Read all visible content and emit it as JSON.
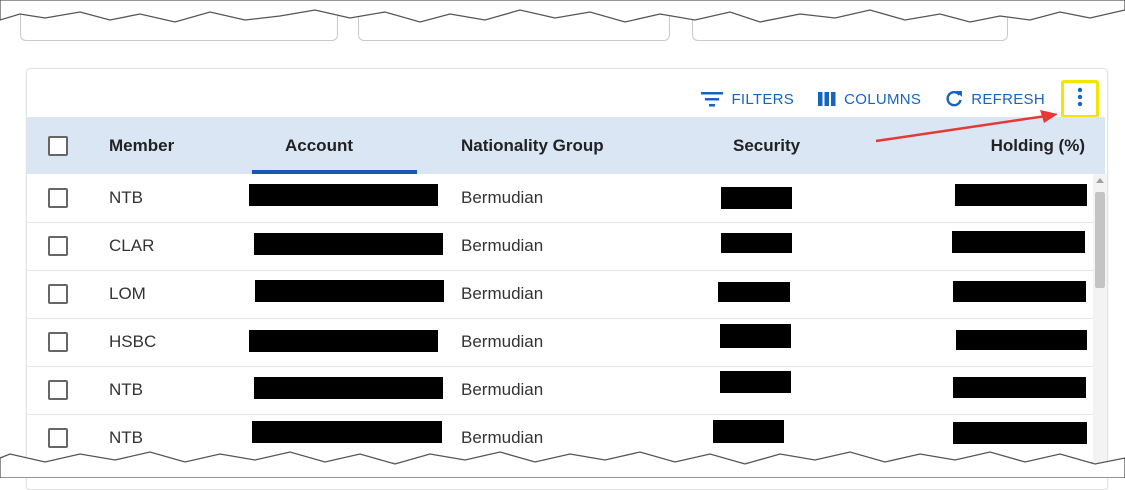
{
  "toolbar": {
    "filters_label": "FILTERS",
    "columns_label": "COLUMNS",
    "refresh_label": "REFRESH",
    "icons": {
      "filters": "filter-lines-icon",
      "columns": "columns-icon",
      "refresh": "refresh-icon",
      "more": "more-vertical-icon"
    }
  },
  "table": {
    "columns": [
      "Member",
      "Account",
      "Nationality Group",
      "Security",
      "Holding (%)"
    ],
    "rows": [
      {
        "member": "NTB",
        "nationality": "Bermudian"
      },
      {
        "member": "CLAR",
        "nationality": "Bermudian"
      },
      {
        "member": "LOM",
        "nationality": "Bermudian"
      },
      {
        "member": "HSBC",
        "nationality": "Bermudian"
      },
      {
        "member": "NTB",
        "nationality": "Bermudian"
      },
      {
        "member": "NTB",
        "nationality": "Bermudian"
      }
    ]
  },
  "colors": {
    "accent": "#1565c0",
    "header_bg": "#dbe6f5",
    "highlight_box": "#f2e600",
    "annotation_arrow": "#e53935"
  }
}
